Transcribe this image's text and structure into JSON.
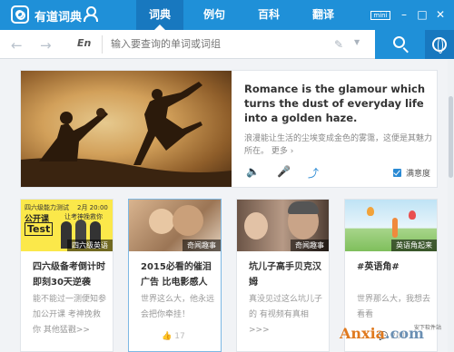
{
  "app": {
    "name": "有道词典"
  },
  "tabs": [
    {
      "label": "词典",
      "active": true
    },
    {
      "label": "例句",
      "active": false
    },
    {
      "label": "百科",
      "active": false
    },
    {
      "label": "翻译",
      "active": false
    }
  ],
  "window": {
    "mini_label": "mini",
    "min": "–",
    "max": "□",
    "close": "✕"
  },
  "search": {
    "lang": "En",
    "placeholder": "输入要查询的单词或词组"
  },
  "hero": {
    "quote": "Romance is the glamour which turns the dust of everyday life into a golden haze.",
    "translation": "浪漫能让生活的尘埃变成金色的雾霭，这便是其魅力所在。",
    "more": "更多 ›",
    "satisfaction": "满意度"
  },
  "cards": [
    {
      "tag": "四六级英语",
      "title": "四六级备考倒计时即刻30天逆袭",
      "desc": "能不能过一测便知参加公开课 考神挽救你 其他猛戳>>",
      "likes": "",
      "banner": {
        "line1": "四六级能力测试",
        "line2": "公开课",
        "line3": "Test",
        "date": "2月 20:00",
        "sub": "让考神挽救你"
      }
    },
    {
      "tag": "奇闻趣事",
      "title": "2015必看的催泪广告 比电影感人",
      "desc": "世界这么大，他永远会把你牵挂！",
      "likes": "17"
    },
    {
      "tag": "奇闻趣事",
      "title": "坑儿子高手贝克汉姆",
      "desc": "真没见过这么坑儿子的 有视频有真相>>>",
      "likes": ""
    },
    {
      "tag": "英语角起来",
      "title": "#英语角#",
      "desc": "世界那么大，我想去看看",
      "likes": "261"
    }
  ],
  "watermark": {
    "brand": "Anxia",
    "dotcom": ".com",
    "sub": "安下软件站"
  },
  "colors": {
    "brand_blue": "#1f90d8",
    "active_tab": "#1878bf",
    "accent": "#2a8ad4"
  }
}
